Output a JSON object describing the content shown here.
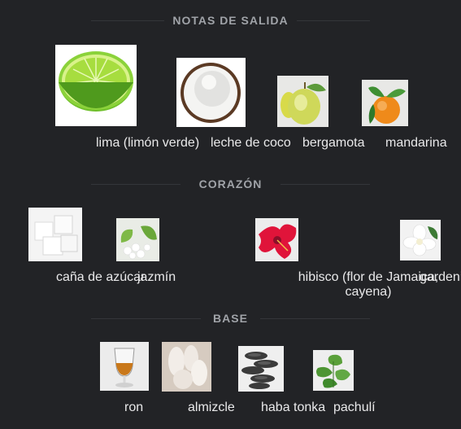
{
  "sections": [
    {
      "title": "NOTAS DE SALIDA",
      "notes": [
        {
          "label": "lima (limón verde)",
          "icon": "lime-icon"
        },
        {
          "label": "leche de coco",
          "icon": "coconut-icon"
        },
        {
          "label": "bergamota",
          "icon": "bergamot-icon"
        },
        {
          "label": "mandarina",
          "icon": "mandarin-icon"
        }
      ]
    },
    {
      "title": "CORAZÓN",
      "notes": [
        {
          "label": "caña de azúcar",
          "icon": "sugar-cubes-icon"
        },
        {
          "label": "jazmín",
          "icon": "jasmine-icon"
        },
        {
          "label": "hibisco (flor de Jamaica, cayena)",
          "icon": "hibiscus-icon"
        },
        {
          "label": "gardenia",
          "icon": "gardenia-icon"
        }
      ]
    },
    {
      "title": "BASE",
      "notes": [
        {
          "label": "ron",
          "icon": "rum-glass-icon"
        },
        {
          "label": "almizcle",
          "icon": "musk-icon"
        },
        {
          "label": "haba tonka",
          "icon": "tonka-bean-icon"
        },
        {
          "label": "pachulí",
          "icon": "patchouli-icon"
        }
      ]
    }
  ]
}
